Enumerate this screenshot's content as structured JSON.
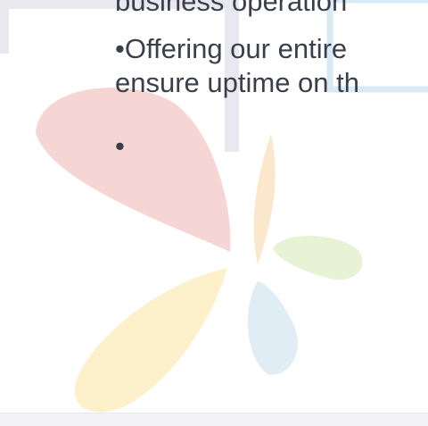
{
  "slide": {
    "lines": [
      "business operation",
      "•Offering our entire",
      "ensure uptime on th",
      "•"
    ]
  },
  "colors": {
    "text": "#3b3f4a",
    "petal_red": "#f5cfcc",
    "petal_orange": "#fbe4c6",
    "petal_yellow": "#fdf0c9",
    "petal_green": "#e6f2d2",
    "petal_blue": "#deecf4",
    "frame_gray": "#e8e8ee",
    "frame_blue": "#d8eaf6"
  }
}
